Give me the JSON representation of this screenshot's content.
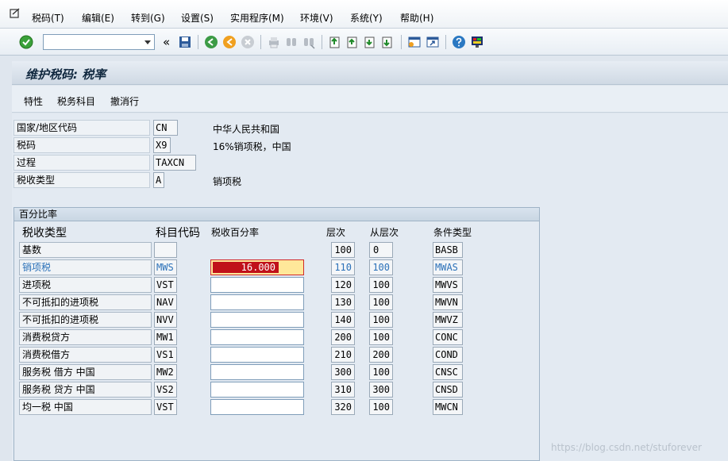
{
  "menubar": {
    "items": [
      "税码(T)",
      "编辑(E)",
      "转到(G)",
      "设置(S)",
      "实用程序(M)",
      "环境(V)",
      "系统(Y)",
      "帮助(H)"
    ]
  },
  "toolbar": {
    "command_value": "",
    "nav_glyph": "«"
  },
  "title": "维护税码: 税率",
  "app_toolbar": [
    "特性",
    "税务科目",
    "撤消行"
  ],
  "header_fields": [
    {
      "label": "国家/地区代码",
      "value": "CN",
      "desc": "中华人民共和国"
    },
    {
      "label": "税码",
      "value": "X9",
      "desc": "16%销项税，中国"
    },
    {
      "label": "过程",
      "value": "TAXCN",
      "desc": ""
    },
    {
      "label": "税收类型",
      "value": "A",
      "desc": "销项税"
    }
  ],
  "group": {
    "title": "百分比率",
    "columns": [
      "税收类型",
      "科目代码",
      "税收百分率",
      "层次",
      "从层次",
      "条件类型"
    ],
    "rows": [
      {
        "type": "基数",
        "code": "",
        "rate": "",
        "level": "100",
        "from": "0",
        "cond": "BASB"
      },
      {
        "type": "销项税",
        "code": "MWS",
        "rate": "16.000",
        "level": "110",
        "from": "100",
        "cond": "MWAS"
      },
      {
        "type": "进项税",
        "code": "VST",
        "rate": "",
        "level": "120",
        "from": "100",
        "cond": "MWVS"
      },
      {
        "type": "不可抵扣的进项税",
        "code": "NAV",
        "rate": "",
        "level": "130",
        "from": "100",
        "cond": "MWVN"
      },
      {
        "type": "不可抵扣的进项税",
        "code": "NVV",
        "rate": "",
        "level": "140",
        "from": "100",
        "cond": "MWVZ"
      },
      {
        "type": "消费税贷方",
        "code": "MW1",
        "rate": "",
        "level": "200",
        "from": "100",
        "cond": "CONC"
      },
      {
        "type": "消费税借方",
        "code": "VS1",
        "rate": "",
        "level": "210",
        "from": "200",
        "cond": "COND"
      },
      {
        "type": "服务税 借方 中国",
        "code": "MW2",
        "rate": "",
        "level": "300",
        "from": "100",
        "cond": "CNSC"
      },
      {
        "type": "服务税 贷方 中国",
        "code": "VS2",
        "rate": "",
        "level": "310",
        "from": "300",
        "cond": "CNSD"
      },
      {
        "type": "均一税 中国",
        "code": "VST",
        "rate": "",
        "level": "320",
        "from": "100",
        "cond": "MWCN"
      }
    ]
  },
  "watermark": "https://blog.csdn.net/stuforever",
  "colors": {
    "active_rate_fill": "#c0111a",
    "active_rate_bg": "#ffe89a",
    "highlight_text": "#2a70b8"
  }
}
